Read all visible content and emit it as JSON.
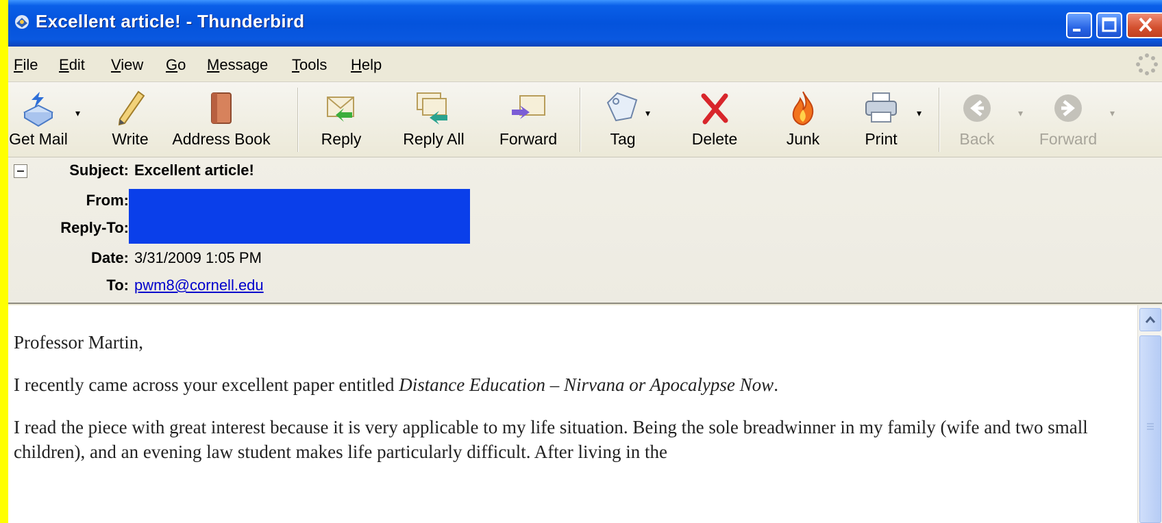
{
  "window": {
    "title": "Excellent article! - Thunderbird"
  },
  "menu": [
    {
      "label": "File",
      "mnemonic": "F",
      "rest": "ile"
    },
    {
      "label": "Edit",
      "mnemonic": "E",
      "rest": "dit"
    },
    {
      "label": "View",
      "mnemonic": "V",
      "rest": "iew"
    },
    {
      "label": "Go",
      "mnemonic": "G",
      "rest": "o"
    },
    {
      "label": "Message",
      "mnemonic": "M",
      "rest": "essage"
    },
    {
      "label": "Tools",
      "mnemonic": "T",
      "rest": "ools"
    },
    {
      "label": "Help",
      "mnemonic": "H",
      "rest": "elp"
    }
  ],
  "toolbar": {
    "get_mail": "Get Mail",
    "write": "Write",
    "address_book": "Address Book",
    "reply": "Reply",
    "reply_all": "Reply All",
    "forward": "Forward",
    "tag": "Tag",
    "delete": "Delete",
    "junk": "Junk",
    "print": "Print",
    "back": "Back",
    "nav_forward": "Forward"
  },
  "headers": {
    "subject_label": "Subject:",
    "subject": "Excellent article!",
    "from_label": "From:",
    "reply_to_label": "Reply-To:",
    "date_label": "Date:",
    "date": "3/31/2009 1:05 PM",
    "to_label": "To:",
    "to": "pwm8@cornell.edu"
  },
  "body": {
    "greeting": "Professor Martin,",
    "p1_before": "I recently came across your excellent paper entitled ",
    "p1_title": "Distance Education – Nirvana or Apocalypse Now",
    "p1_after": ".",
    "p2": "I read the piece with great interest because it is very applicable to my life situation.  Being the sole breadwinner in my family (wife and two small children), and an evening law student makes life particularly difficult.  After living in the"
  },
  "colors": {
    "titlebar": "#0453DC",
    "chrome": "#ECE9D8",
    "redaction": "#0A3FEA",
    "link": "#0000CC",
    "background": "#FFFF00"
  }
}
